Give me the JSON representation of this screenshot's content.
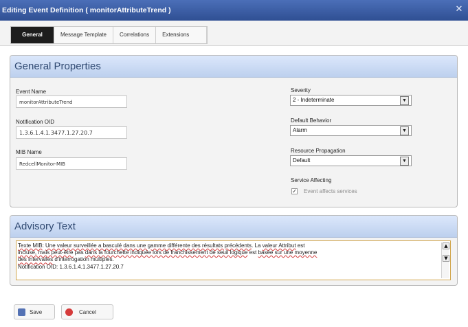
{
  "window": {
    "title": "Editing Event Definition ( monitorAttributeTrend )",
    "close_glyph": "✕"
  },
  "tabs": [
    "General",
    "Message Template",
    "Correlations",
    "Extensions"
  ],
  "general": {
    "header": "General Properties",
    "event_name_label": "Event Name",
    "event_name_value": "monitorAttributeTrend",
    "notification_oid_label": "Notification OID",
    "notification_oid_value": "1.3.6.1.4.1.3477.1.27.20.7",
    "mib_name_label": "MIB Name",
    "mib_name_value": "RedcellMonitor-MIB",
    "severity_label": "Severity",
    "severity_value": "2 - Indeterminate",
    "default_behavior_label": "Default Behavior",
    "default_behavior_value": "Alarm",
    "resource_propagation_label": "Resource Propagation",
    "resource_propagation_value": "Default",
    "service_affecting_label": "Service Affecting",
    "service_affecting_checkbox_label": "Event affects services"
  },
  "advisory": {
    "header": "Advisory Text",
    "line1_a": "Texte MIB",
    "line1_b": ": ",
    "line1_c": "Une valeur surveillée a basculé dans une gamme différente des résultats précédents",
    "line1_d": ". La ",
    "line1_e": "valeur Attribut",
    "line1_f": " est",
    "line2_a": "incluse, mais peut-être",
    "line2_b": " pas ",
    "line2_c": "dans la fourchette indiquée lors de franchissement de seuil logique",
    "line2_d": " est ",
    "line2_e": "basée sur une moyenne",
    "line3_a": "des intervalles",
    "line3_b": " d'interrogation multiples.",
    "line4": "Notification OID: 1.3.6.1.4.1.3477.1.27.20.7"
  },
  "footer": {
    "save_label": "Save",
    "cancel_label": "Cancel"
  },
  "colors": {
    "accent": "#3a5ca8",
    "panel_header": "#c9d9f3"
  }
}
